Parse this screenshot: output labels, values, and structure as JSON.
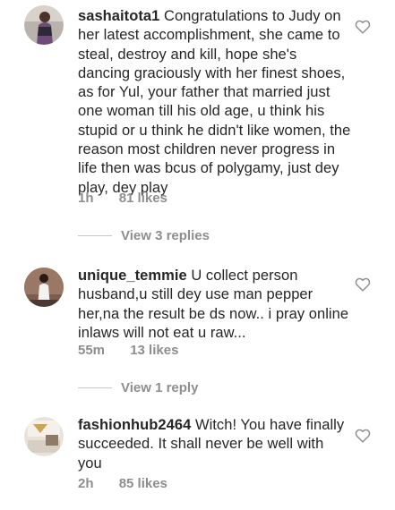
{
  "comments": [
    {
      "username": "sashaitota1",
      "text": "Congratulations to Judy on her latest accomplishment, she came to steal, destroy and kill, hope she's dancing graciously with her finest shoes, as for Yul, your father that married just one woman till his old age, u think his stupid or u think he didn't like women, the reason most children never progress in life then was bcus of polygamy, just dey play, dey play",
      "time": "1h",
      "likes": "81 likes",
      "replies": "View 3 replies",
      "icon": "heart-outline-icon"
    },
    {
      "username": "unique_temmie",
      "text": "U collect person husband,u still dey use man pepper her,na the result be ds now.. i pray online inlaws will not eat u raw...",
      "time": "55m",
      "likes": "13 likes",
      "replies": "View 1 reply",
      "icon": "heart-outline-icon"
    },
    {
      "username": "fashionhub2464",
      "text": "Witch! You have finally succeeded. It shall never be well with you",
      "time": "2h",
      "likes": "85 likes",
      "icon": "heart-outline-icon"
    }
  ],
  "colors": {
    "text": "#262626",
    "secondary": "#8e8e8e",
    "divider": "#c7c7c7"
  }
}
